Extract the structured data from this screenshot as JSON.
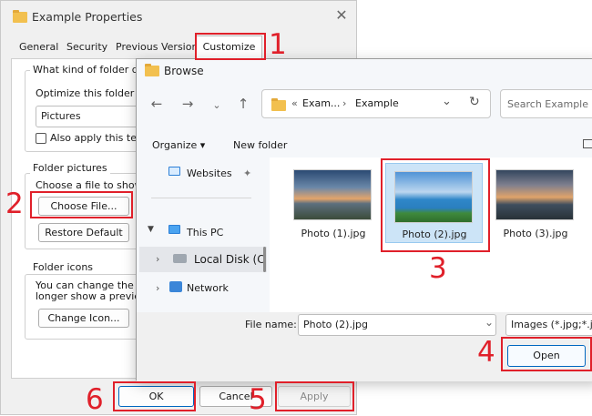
{
  "properties": {
    "title": "Example Properties",
    "close": "✕",
    "tabs": [
      "General",
      "Security",
      "Previous Versions",
      "Customize"
    ],
    "kind_group": "What kind of folder do y",
    "optimize_label": "Optimize this folder for:",
    "optimize_value": "Pictures",
    "apply_checkbox_label": "Also apply this temp",
    "pictures_group": "Folder pictures",
    "choose_text": "Choose a file to show o",
    "choose_button": "Choose File...",
    "restore_button": "Restore Default",
    "icons_group": "Folder icons",
    "icons_text_1": "You can change the fol",
    "icons_text_2": "longer show a preview",
    "change_icon_button": "Change Icon...",
    "ok_button": "OK",
    "cancel_button": "Cancel",
    "apply_button": "Apply"
  },
  "browse": {
    "title": "Browse",
    "close": "✕",
    "address": {
      "prefix": "«",
      "parts": [
        "Exam...",
        "Example"
      ]
    },
    "search_placeholder": "Search Example",
    "organize_label": "Organize ▾",
    "new_folder_label": "New folder",
    "nav": [
      "Websites",
      "This PC",
      "Local Disk (C",
      "Network"
    ],
    "files": [
      {
        "name": "Photo (1).jpg",
        "selected": false
      },
      {
        "name": "Photo (2).jpg",
        "selected": true
      },
      {
        "name": "Photo (3).jpg",
        "selected": false
      }
    ],
    "file_name_label": "File name:",
    "file_name_value": "Photo (2).jpg",
    "filter_value": "Images (*.jpg;*.jp",
    "open_button": "Open"
  },
  "annotations": [
    "1",
    "2",
    "3",
    "4",
    "5",
    "6"
  ],
  "colors": {
    "annotation": "#e0202a",
    "selection": "#cce4f7",
    "folder": "#f2c04f",
    "primary_border": "#0067c0"
  }
}
